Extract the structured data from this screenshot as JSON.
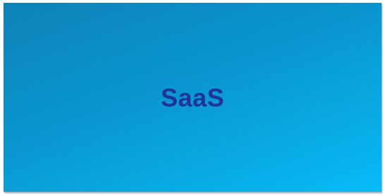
{
  "slide": {
    "title": "SaaS",
    "background_colors": [
      "#0c82b8",
      "#08bbf7"
    ],
    "title_color": "#23329a"
  }
}
